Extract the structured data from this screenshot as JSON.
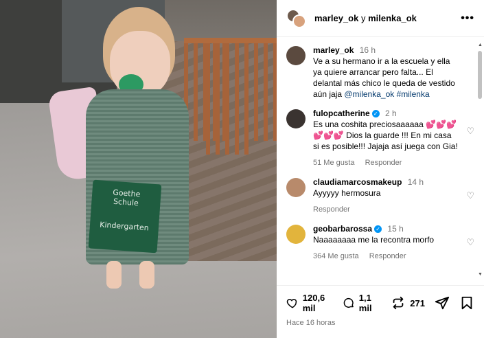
{
  "photo": {
    "pocket_line1": "Goethe",
    "pocket_line2": "Schule",
    "pocket_line3": "Kindergarten"
  },
  "header": {
    "user1": "marley_ok",
    "joiner": " y ",
    "user2": "milenka_ok"
  },
  "caption": {
    "user": "marley_ok",
    "time": "16 h",
    "text": "Ve a su hermano ir a la escuela y ella ya quiere arrancar pero falta... El delantal más chico le queda de vestido aún jaja ",
    "mention": "@milenka_ok",
    "hashtag": "#milenka"
  },
  "comments": [
    {
      "user": "fulopcatherine",
      "verified": true,
      "time": "2 h",
      "text": "Es una coshita preciosaaaaaa 💕💕💕💕💕💕 Dios la guarde !!! En mi casa si es posible!!! Jajaja así juega con Gia!",
      "likes": "51 Me gusta",
      "reply": "Responder"
    },
    {
      "user": "claudiamarcosmakeup",
      "verified": false,
      "time": "14 h",
      "text": "Ayyyyy hermosura",
      "likes": "",
      "reply": "Responder"
    },
    {
      "user": "geobarbarossa",
      "verified": true,
      "time": "15 h",
      "text": "Naaaaaaaa me la recontra morfo",
      "likes": "364 Me gusta",
      "reply": "Responder"
    }
  ],
  "actions": {
    "likes": "120,6 mil",
    "comments": "1,1 mil",
    "reposts": "271",
    "posted": "Hace 16 horas"
  },
  "colors": {
    "verified": "#0095f6",
    "muted": "#737373",
    "link": "#00376b"
  }
}
